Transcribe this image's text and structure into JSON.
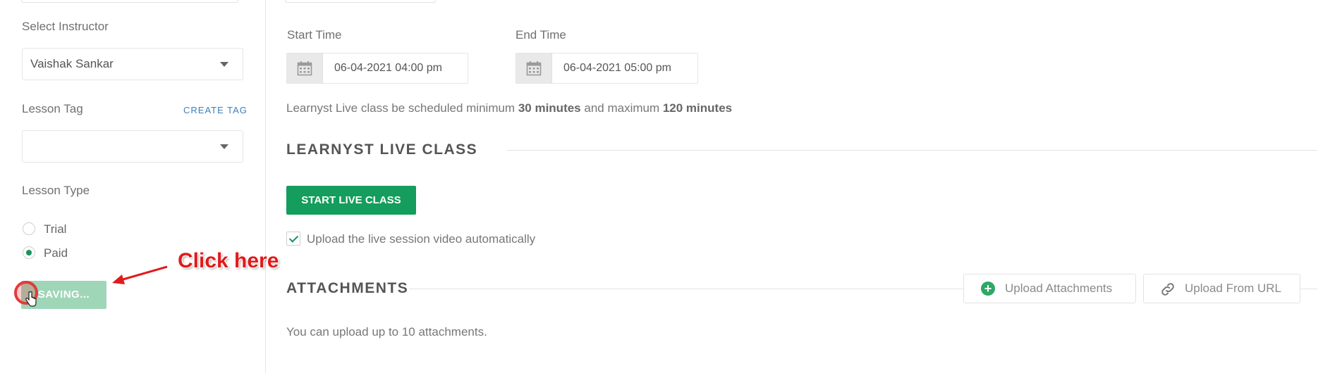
{
  "sidebar": {
    "instructor": {
      "label": "Select Instructor",
      "value": "Vaishak Sankar"
    },
    "lesson_tag": {
      "label": "Lesson Tag",
      "create_link": "CREATE TAG",
      "value": ""
    },
    "lesson_type": {
      "label": "Lesson Type",
      "options": [
        {
          "label": "Trial",
          "selected": false
        },
        {
          "label": "Paid",
          "selected": true
        }
      ]
    },
    "save_button_label": "SAVING..."
  },
  "annotation": {
    "text": "Click here",
    "color": "#e01b1b"
  },
  "schedule": {
    "start": {
      "label": "Start Time",
      "value": "06-04-2021 04:00 pm"
    },
    "end": {
      "label": "End Time",
      "value": "06-04-2021 05:00 pm"
    },
    "hint": {
      "prefix": "Learnyst Live class be scheduled minimum ",
      "min": "30 minutes",
      "middle": " and maximum ",
      "max": "120 minutes"
    }
  },
  "live_class": {
    "title": "LEARNYST LIVE CLASS",
    "start_button": "START LIVE CLASS",
    "auto_upload": {
      "label": "Upload the live session video automatically",
      "checked": true
    }
  },
  "attachments": {
    "title": "ATTACHMENTS",
    "upload_button": "Upload Attachments",
    "url_button": "Upload From URL",
    "note": "You can upload up to 10 attachments."
  },
  "colors": {
    "primary_green": "#149d5c",
    "saving_button": "#9fd6b8",
    "link_blue": "#3d7fb8",
    "annotation_red": "#e01b1b"
  }
}
